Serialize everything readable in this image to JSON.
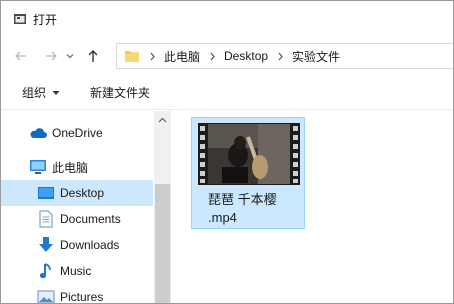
{
  "window": {
    "title": "打开",
    "icon": "open-dialog-icon"
  },
  "navigation": {
    "back_icon": "arrow-left-icon",
    "forward_icon": "arrow-right-icon",
    "recent_icon": "chevron-down-icon",
    "up_icon": "arrow-up-icon"
  },
  "address": {
    "folder_icon": "folder-icon",
    "crumbs": [
      "此电脑",
      "Desktop",
      "实验文件"
    ]
  },
  "commands": {
    "organize": "组织",
    "new_folder": "新建文件夹"
  },
  "sidebar": {
    "items": [
      {
        "label": "OneDrive",
        "icon": "onedrive-cloud-icon"
      },
      {
        "label": "此电脑",
        "icon": "this-pc-icon"
      },
      {
        "label": "Desktop",
        "icon": "desktop-icon",
        "selected": true
      },
      {
        "label": "Documents",
        "icon": "documents-icon"
      },
      {
        "label": "Downloads",
        "icon": "downloads-icon"
      },
      {
        "label": "Music",
        "icon": "music-icon"
      },
      {
        "label": "Pictures",
        "icon": "pictures-icon"
      }
    ]
  },
  "files": [
    {
      "name_line1": "琵琶 千本樱",
      "name_line2": ".mp4",
      "icon": "video-thumbnail-icon",
      "selected": true
    }
  ],
  "colors": {
    "selection": "#cce8ff",
    "selection_border": "#99d1ff",
    "accent": "#0078d7",
    "folder": "#f5c94a"
  }
}
